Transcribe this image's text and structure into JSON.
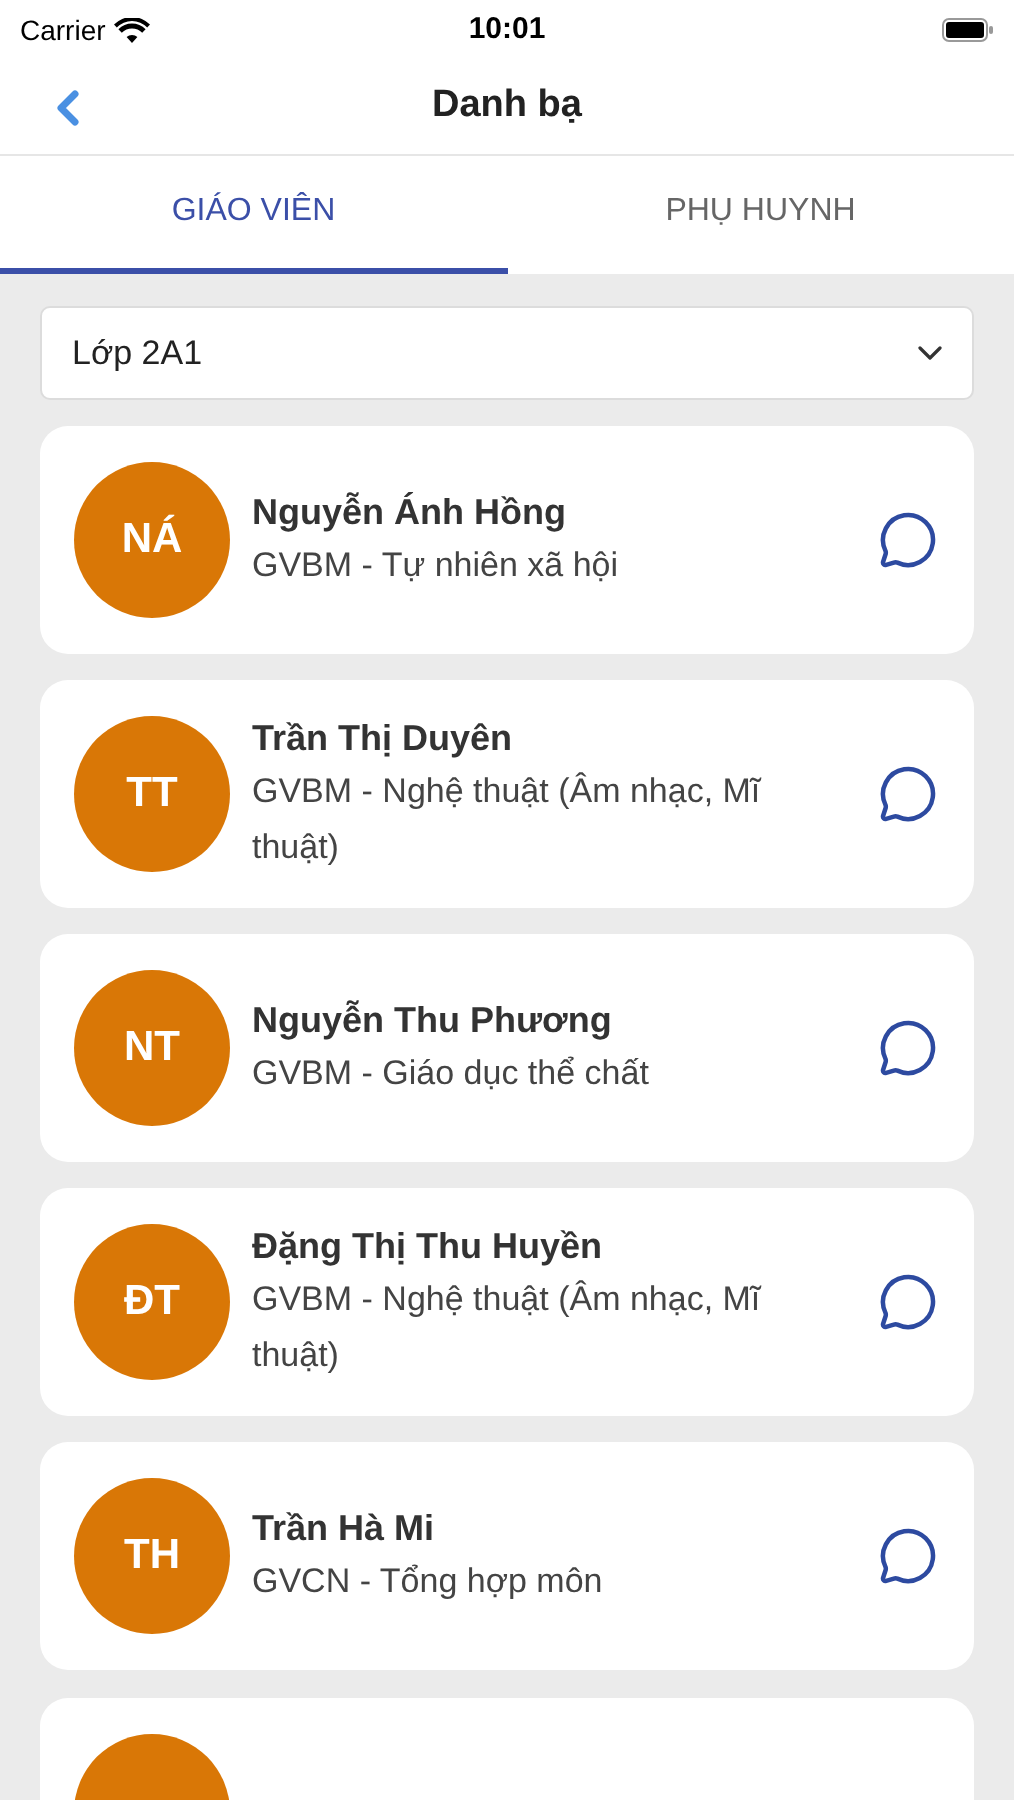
{
  "status_bar": {
    "carrier": "Carrier",
    "time": "10:01"
  },
  "nav": {
    "title": "Danh bạ"
  },
  "tabs": [
    {
      "label": "GIÁO VIÊN",
      "selected": true
    },
    {
      "label": "PHỤ HUYNH",
      "selected": false
    }
  ],
  "class_select": {
    "value": "Lớp 2A1"
  },
  "contacts": [
    {
      "kind": "full",
      "initials": "NÁ",
      "name": "Nguyễn Ánh Hồng",
      "role": "GVBM - Tự nhiên xã hội"
    },
    {
      "kind": "full",
      "initials": "TT",
      "name": "Trần Thị Duyên",
      "role": "GVBM - Nghệ thuật (Âm nhạc, Mĩ thuật)"
    },
    {
      "kind": "full",
      "initials": "NT",
      "name": "Nguyễn Thu Phương",
      "role": "GVBM - Giáo dục thể chất"
    },
    {
      "kind": "full",
      "initials": "ĐT",
      "name": "Đặng Thị Thu Huyền",
      "role": "GVBM - Nghệ thuật (Âm nhạc, Mĩ thuật)"
    },
    {
      "kind": "full",
      "initials": "TH",
      "name": "Trần Hà Mi",
      "role": "GVCN - Tổng hợp môn"
    },
    {
      "kind": "partial"
    }
  ]
}
